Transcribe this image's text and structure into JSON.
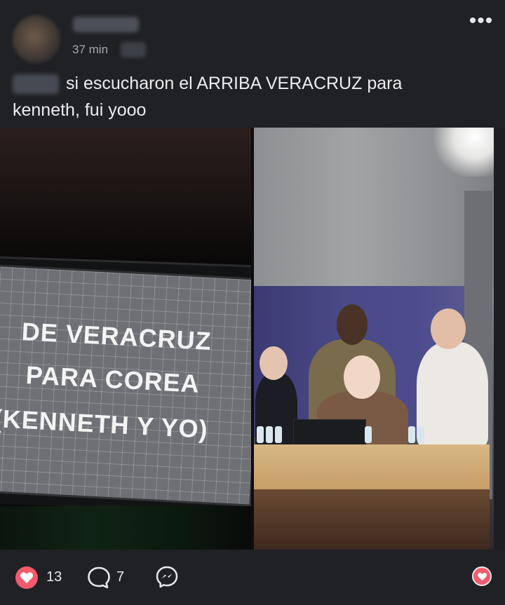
{
  "post": {
    "time": "37 min",
    "text_line1": "si escucharon el ARRIBA VERACRUZ para",
    "text_line2": "kenneth,  fui yooo"
  },
  "left_image": {
    "sign_lines": [
      "DE VERACRUZ",
      "PARA COREA",
      "(KENNETH Y YO)"
    ]
  },
  "actions": {
    "likes": "13",
    "comments": "7"
  },
  "icons": {
    "more": "more-dots-icon",
    "like": "heart-icon",
    "comment": "comment-bubble-icon",
    "share": "messenger-icon",
    "reaction": "heart-icon"
  },
  "colors": {
    "background": "#202125",
    "accent_like": "#f35a6c",
    "text": "#ececef",
    "muted": "#a5a7ad"
  }
}
